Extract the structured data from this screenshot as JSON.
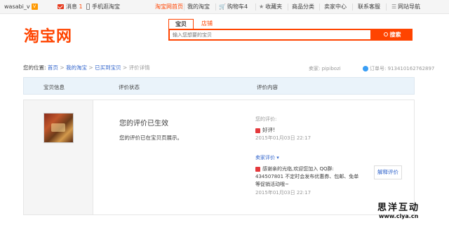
{
  "topbar": {
    "username": "wasabi_v",
    "vip_badge": "V",
    "messages_label": "消息",
    "messages_count": "1",
    "mobile_label": "手机逛淘宝",
    "home_link": "淘宝网首页",
    "my_taobao": "我的淘宝",
    "cart_label": "购物车4",
    "favorites_label": "收藏夹",
    "categories_label": "商品分类",
    "seller_center": "卖家中心",
    "contact_service": "联系客服",
    "site_nav": "网站导航"
  },
  "header": {
    "logo_text": "淘宝网",
    "tab_items": "宝贝",
    "tab_shops": "店铺",
    "search_placeholder": "输入您想要的宝贝",
    "search_button": "搜索"
  },
  "breadcrumb": {
    "prefix": "您的位置:",
    "home": "首页",
    "my_taobao": "我的淘宝",
    "bought": "已买到宝贝",
    "current": "评价详情",
    "sep": ">"
  },
  "order_meta": {
    "seller": "卖家: pipibozi",
    "order_no": "订单号: 913410162762897"
  },
  "table_header": {
    "col_item": "宝贝信息",
    "col_status": "评价状态",
    "col_content": "评价内容"
  },
  "review": {
    "status_title": "您的评价已生效",
    "status_sub": "您的评价已在宝贝页展示。",
    "my_review_label": "您的评价:",
    "rating_text": "好评!",
    "my_review_date": "2015年01月03日 22:17",
    "seller_review_label": "卖家评价 ▾",
    "seller_reply": "感谢亲的光临,欢迎您加入 QQ群: 434507801 不定时会发布优惠券、包邮、免单等促销活动哦~",
    "seller_reply_date": "2015年01月03日 22:17",
    "explain_button": "解释评价"
  },
  "watermark": {
    "brand": "思洋互动",
    "url": "www.ciya.cn"
  },
  "colors": {
    "brand": "#ff4400",
    "link": "#3366cc",
    "header_bg": "#eaf3fa"
  }
}
